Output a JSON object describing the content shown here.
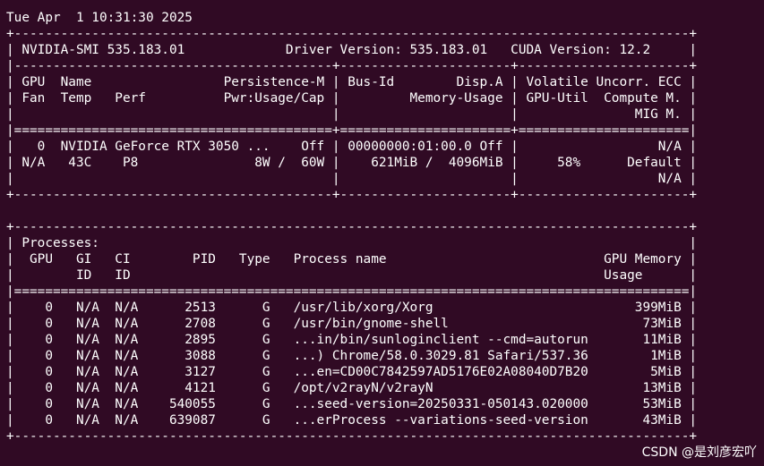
{
  "colors": {
    "background": "#300a24",
    "foreground": "#ffffff"
  },
  "terminal": {
    "lines": [
      "Tue Apr  1 10:31:30 2025",
      "+---------------------------------------------------------------------------------------+",
      "| NVIDIA-SMI 535.183.01             Driver Version: 535.183.01   CUDA Version: 12.2     |",
      "|-----------------------------------------+----------------------+----------------------+",
      "| GPU  Name                 Persistence-M | Bus-Id        Disp.A | Volatile Uncorr. ECC |",
      "| Fan  Temp   Perf          Pwr:Usage/Cap |         Memory-Usage | GPU-Util  Compute M. |",
      "|                                         |                      |               MIG M. |",
      "|=========================================+======================+======================|",
      "|   0  NVIDIA GeForce RTX 3050 ...    Off | 00000000:01:00.0 Off |                  N/A |",
      "| N/A   43C    P8               8W /  60W |    621MiB /  4096MiB |     58%      Default |",
      "|                                         |                      |                  N/A |",
      "+-----------------------------------------+----------------------+----------------------+",
      "",
      "+---------------------------------------------------------------------------------------+",
      "| Processes:                                                                            |",
      "|  GPU   GI   CI        PID   Type   Process name                            GPU Memory |",
      "|        ID   ID                                                             Usage      |",
      "|=======================================================================================|",
      "|    0   N/A  N/A      2513      G   /usr/lib/xorg/Xorg                          399MiB |",
      "|    0   N/A  N/A      2708      G   /usr/bin/gnome-shell                         73MiB |",
      "|    0   N/A  N/A      2895      G   ...in/bin/sunloginclient --cmd=autorun       11MiB |",
      "|    0   N/A  N/A      3088      G   ...) Chrome/58.0.3029.81 Safari/537.36        1MiB |",
      "|    0   N/A  N/A      3127      G   ...en=CD00C7842597AD5176E02A08040D7B20        5MiB |",
      "|    0   N/A  N/A      4121      G   /opt/v2rayN/v2rayN                           13MiB |",
      "|    0   N/A  N/A    540055      G   ...seed-version=20250331-050143.020000       53MiB |",
      "|    0   N/A  N/A    639087      G   ...erProcess --variations-seed-version       43MiB |",
      "+---------------------------------------------------------------------------------------+"
    ]
  },
  "watermark": "CSDN @是刘彦宏吖"
}
